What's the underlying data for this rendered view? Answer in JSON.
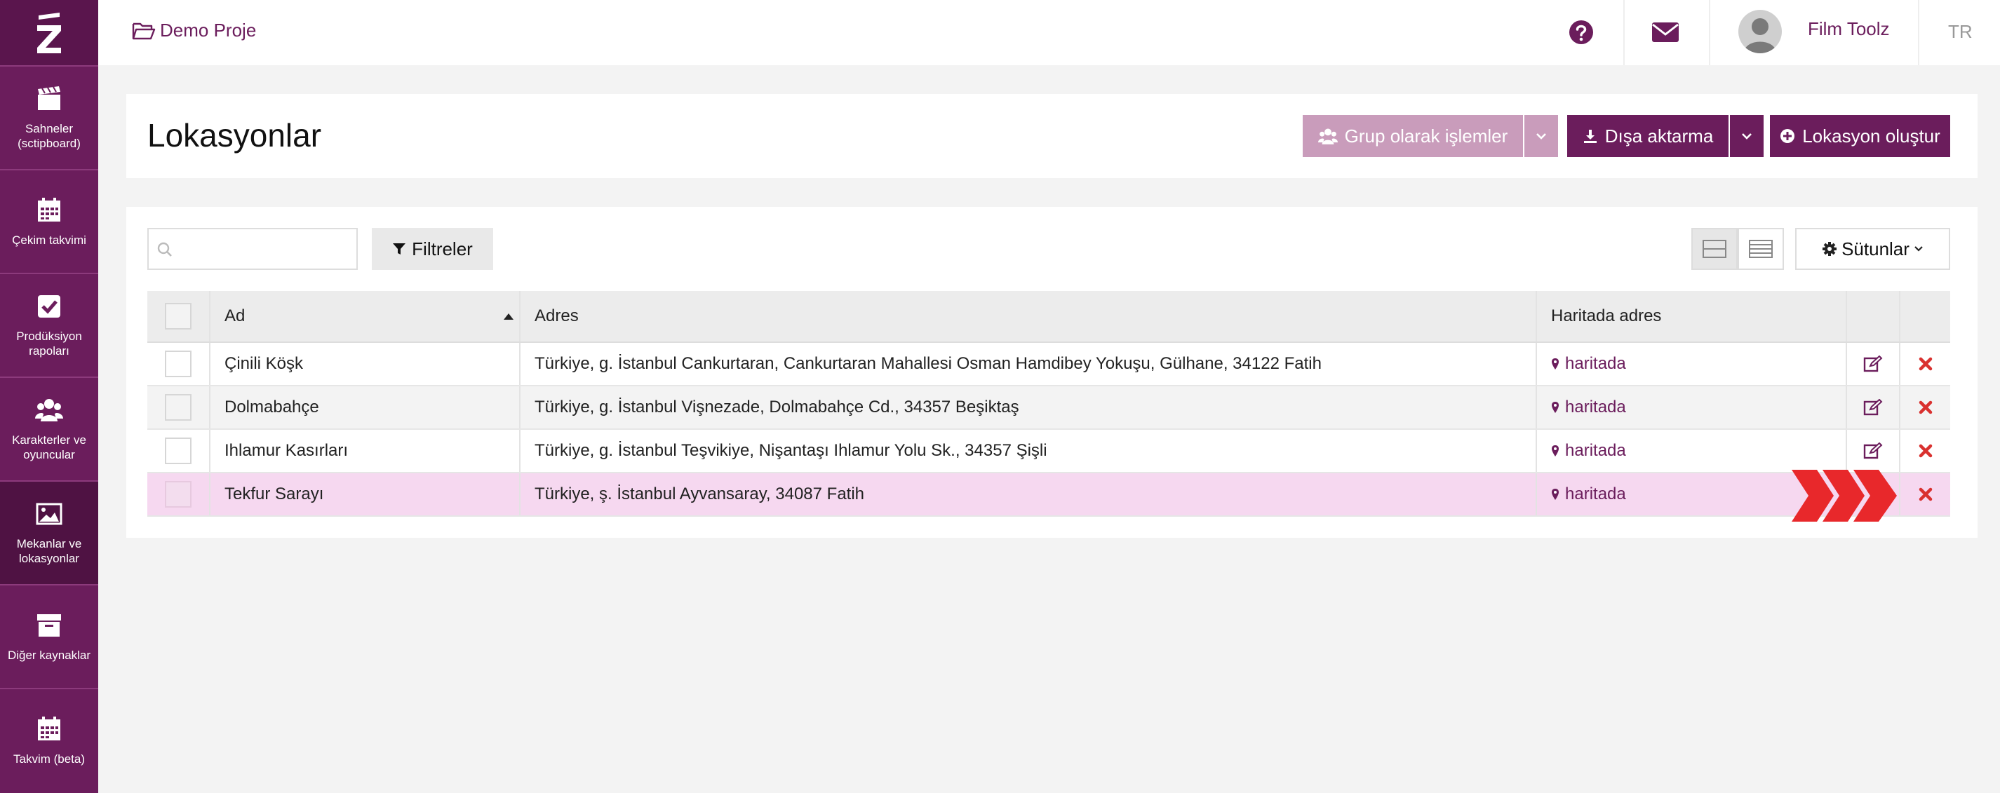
{
  "sidebar": {
    "logo_icon": "filmtoolz-logo-icon",
    "items": [
      {
        "label": "Sahneler\n(sctipboard)",
        "icon": "clapperboard-icon"
      },
      {
        "label": "Çekim takvimi",
        "icon": "calendar-icon"
      },
      {
        "label": "Prodüksiyon\nrapoları",
        "icon": "checkbox-icon"
      },
      {
        "label": "Karakterler ve\noyuncular",
        "icon": "users-icon"
      },
      {
        "label": "Mekanlar ve\nlokasyonlar",
        "icon": "image-icon"
      },
      {
        "label": "Diğer kaynaklar",
        "icon": "archive-icon"
      },
      {
        "label": "Takvim (beta)",
        "icon": "calendar-icon"
      }
    ]
  },
  "topbar": {
    "project": "Demo Proje",
    "user_name": "Film Toolz",
    "lang": "TR"
  },
  "header": {
    "title": "Lokasyonlar",
    "group_actions_label": "Grup olarak işlemler",
    "export_label": "Dışa aktarma",
    "create_label": "Lokasyon oluştur"
  },
  "toolbar": {
    "search_placeholder": "",
    "filters_label": "Filtreler",
    "columns_label": "Sütunlar"
  },
  "table": {
    "columns": [
      "Ad",
      "Adres",
      "Haritada adres"
    ],
    "rows": [
      {
        "name": "Çinili Köşk",
        "address": "Türkiye, g. İstanbul Cankurtaran, Cankurtaran Mahallesi Osman Hamdibey Yokuşu, Gülhane, 34122 Fatih",
        "map": "haritada"
      },
      {
        "name": "Dolmabahçe",
        "address": "Türkiye, g. İstanbul Vişnezade, Dolmabahçe Cd., 34357 Beşiktaş",
        "map": "haritada"
      },
      {
        "name": "Ihlamur Kasırları",
        "address": "Türkiye, g. İstanbul Teşvikiye, Nişantaşı Ihlamur Yolu Sk., 34357 Şişli",
        "map": "haritada"
      },
      {
        "name": "Tekfur Sarayı",
        "address": "Türkiye, ş. İstanbul Ayvansaray, 34087 Fatih",
        "map": "haritada"
      }
    ]
  },
  "colors": {
    "brand": "#6b1d5c",
    "highlight_row": "#f6d8f0",
    "delete": "#d9312f",
    "arrow": "#e8282b"
  }
}
